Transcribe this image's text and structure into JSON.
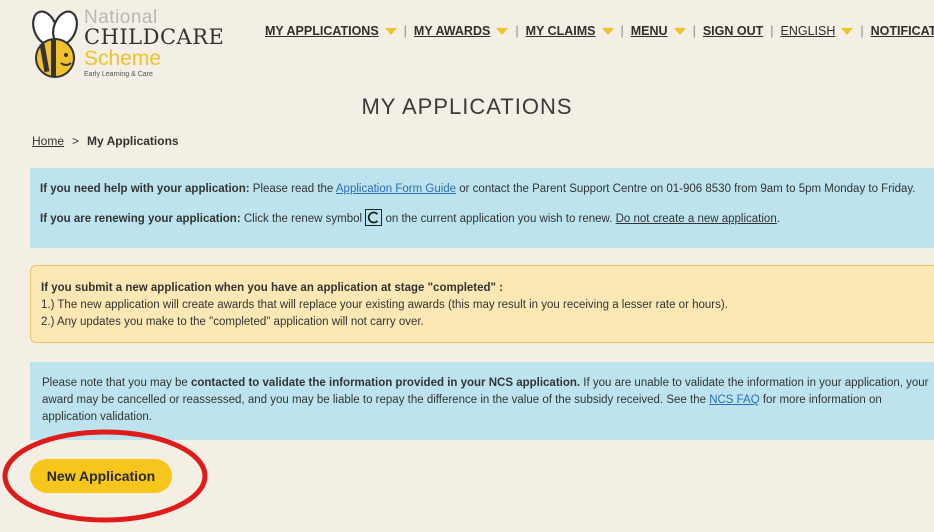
{
  "logo": {
    "line1": "National",
    "line2": "CHILDCARE",
    "line3": "Scheme",
    "line4": "Early Learning & Care"
  },
  "nav": {
    "my_applications": "MY APPLICATIONS",
    "my_awards": "MY AWARDS",
    "my_claims": "MY CLAIMS",
    "menu": "MENU",
    "sign_out": "SIGN OUT",
    "language": "ENGLISH",
    "notifications": "NOTIFICATIONS"
  },
  "page_title": "MY APPLICATIONS",
  "breadcrumb": {
    "home": "Home",
    "separator": ">",
    "current": "My Applications"
  },
  "help_box": {
    "line1_bold": "If you need help with your application:",
    "line1_pre": " Please read the ",
    "line1_link": "Application Form Guide",
    "line1_post": " or contact the Parent Support Centre on 01-906 8530 from 9am to 5pm Monday to Friday.",
    "line2_bold": "If you are renewing your application:",
    "line2_pre": " Click the renew symbol ",
    "line2_mid": " on the current application you wish to renew. ",
    "line2_link": "Do not create a new application",
    "line2_post": "."
  },
  "warning_box": {
    "heading": "If you submit a new application when you have an application at stage \"completed\" :",
    "item1": "1.) The new application will create awards that will replace your existing awards (this may result in you receiving a lesser rate or hours).",
    "item2": "2.) Any updates you make to the \"completed\" application will not carry over."
  },
  "validation_box": {
    "pre": "Please note that you may be ",
    "bold": "contacted to validate the information provided in your NCS application.",
    "mid": " If you are unable to validate the information in your application, your award may be cancelled or reassessed, and you may be liable to repay the difference in the value of the subsidy received. See the ",
    "link": "NCS FAQ",
    "post": " for more information on application validation."
  },
  "new_application_button": "New Application",
  "colors": {
    "background": "#f3efe4",
    "info_box": "#bde4ee",
    "warning_box": "#fbe8b4",
    "accent_yellow": "#f6c61d",
    "annotation_red": "#e01b1b",
    "link_blue": "#2a6fb5"
  }
}
